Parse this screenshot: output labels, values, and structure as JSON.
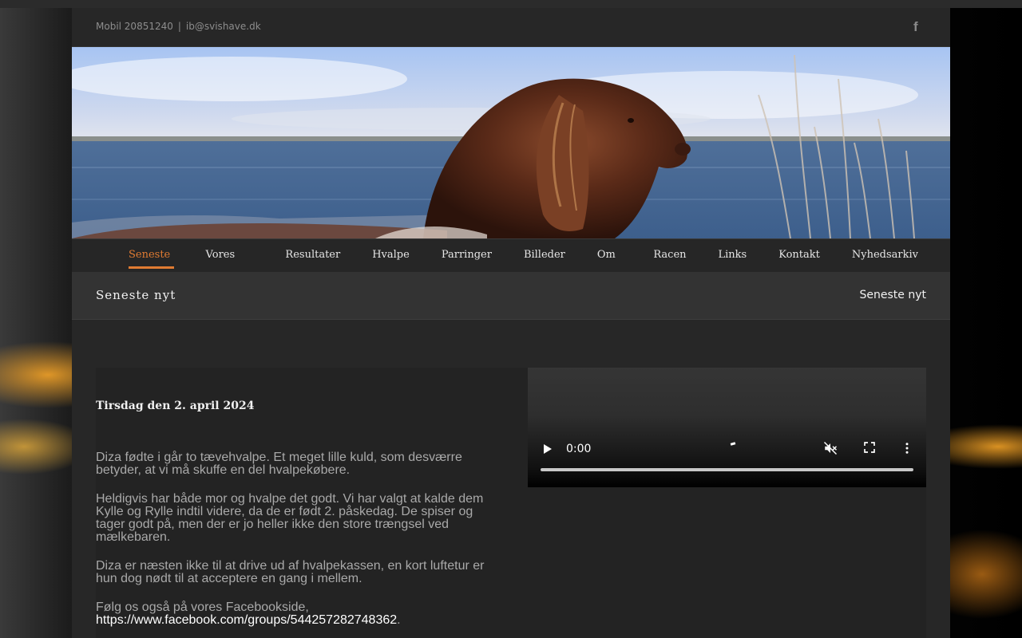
{
  "header": {
    "phone": "Mobil 20851240",
    "separator": "|",
    "email": "ib@svishave.dk",
    "social_icon": "facebook-icon"
  },
  "nav": {
    "items": [
      {
        "label": "Seneste nyt",
        "active": true
      },
      {
        "label": "Vores hunde"
      },
      {
        "label": "Resultater"
      },
      {
        "label": "Hvalpe"
      },
      {
        "label": "Parringer"
      },
      {
        "label": "Billeder"
      },
      {
        "label": "Om os"
      },
      {
        "label": "Racen"
      },
      {
        "label": "Links"
      },
      {
        "label": "Kontakt"
      },
      {
        "label": "Nyhedsarkiv"
      }
    ],
    "active_color": "#e07b32"
  },
  "pagebar": {
    "title": "Seneste nyt",
    "breadcrumb": "Seneste nyt"
  },
  "article": {
    "date": "Tirsdag den 2. april 2024",
    "paragraphs": [
      "Diza fødte i går to tævehvalpe. Et meget lille kuld, som desværre betyder, at vi må skuffe en del hvalpekøbere.",
      "Heldigvis har både mor og hvalpe det godt. Vi har valgt at kalde dem Kylle og Rylle indtil videre, da de er født 2. påskedag. De spiser og tager godt på, men der er jo heller ikke den store trængsel ved mælkebaren.",
      "Diza er næsten ikke til at drive ud af hvalpekassen, en kort luftetur er hun dog nødt til at acceptere en gang i mellem."
    ],
    "follow_text": "Følg os også på vores Facebookside,",
    "follow_link": "https://www.facebook.com/groups/544257282748362",
    "follow_end": "."
  },
  "video": {
    "time": "0:00",
    "icons": [
      "play-icon",
      "mute-icon",
      "fullscreen-icon",
      "more-icon"
    ]
  }
}
